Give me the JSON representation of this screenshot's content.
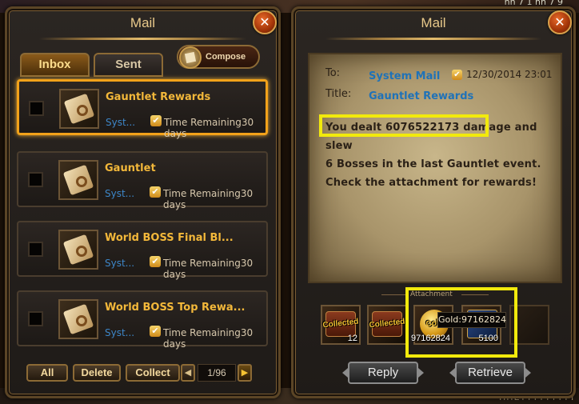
{
  "game_top_text": "hh 7 1 hh 7 9",
  "bottom_text": "HHEYYYYYYYYY",
  "left_panel": {
    "title": "Mail",
    "close_glyph": "✕",
    "tabs": [
      {
        "label": "Inbox",
        "active": true
      },
      {
        "label": "Sent",
        "active": false
      }
    ],
    "compose_label": "Compose",
    "mails": [
      {
        "title": "Gauntlet Rewards",
        "sender": "Syst...",
        "time": "Time Remaining30 days",
        "selected": true,
        "icon": "scroll-icon"
      },
      {
        "title": "Gauntlet",
        "sender": "Syst...",
        "time": "Time Remaining30 days",
        "selected": false,
        "icon": "scroll-icon"
      },
      {
        "title": "World BOSS Final Bl...",
        "sender": "Syst...",
        "time": "Time Remaining30 days",
        "selected": false,
        "icon": "scroll-icon"
      },
      {
        "title": "World BOSS Top Rewa...",
        "sender": "Syst...",
        "time": "Time Remaining30 days",
        "selected": false,
        "icon": "scroll-icon"
      }
    ],
    "controls": {
      "all": "All",
      "delete": "Delete",
      "collect": "Collect",
      "prev_glyph": "◀",
      "next_glyph": "▶",
      "page": "1/96"
    }
  },
  "right_panel": {
    "title": "Mail",
    "close_glyph": "✕",
    "to_label": "To:",
    "to_value": "System Mail",
    "date": "12/30/2014 23:01",
    "title_label": "Title:",
    "title_value": "Gauntlet Rewards",
    "body_lines": [
      "You dealt 6076522173 damage and slew",
      "6 Bosses in the last Gauntlet event.",
      "Check the attachment for rewards!"
    ],
    "attachment_label": "Attachment",
    "attachments": [
      {
        "icon": "chest-icon",
        "status": "Collected",
        "count": "12"
      },
      {
        "icon": "chest-icon",
        "status": "Collected",
        "count": ""
      },
      {
        "icon": "gold-coin-icon",
        "status": "Coll",
        "count": "97162824"
      },
      {
        "icon": "book-icon",
        "status": "",
        "count": "5100"
      },
      {
        "icon": "empty-slot",
        "status": "",
        "count": ""
      }
    ],
    "tooltip": "Gold:97162824",
    "reply_label": "Reply",
    "retrieve_label": "Retrieve"
  },
  "colors": {
    "gold_text": "#f3b83a",
    "link_blue": "#1f72b8",
    "highlight_yellow": "#f2ea0c",
    "selected_orange": "#f2a21a"
  }
}
